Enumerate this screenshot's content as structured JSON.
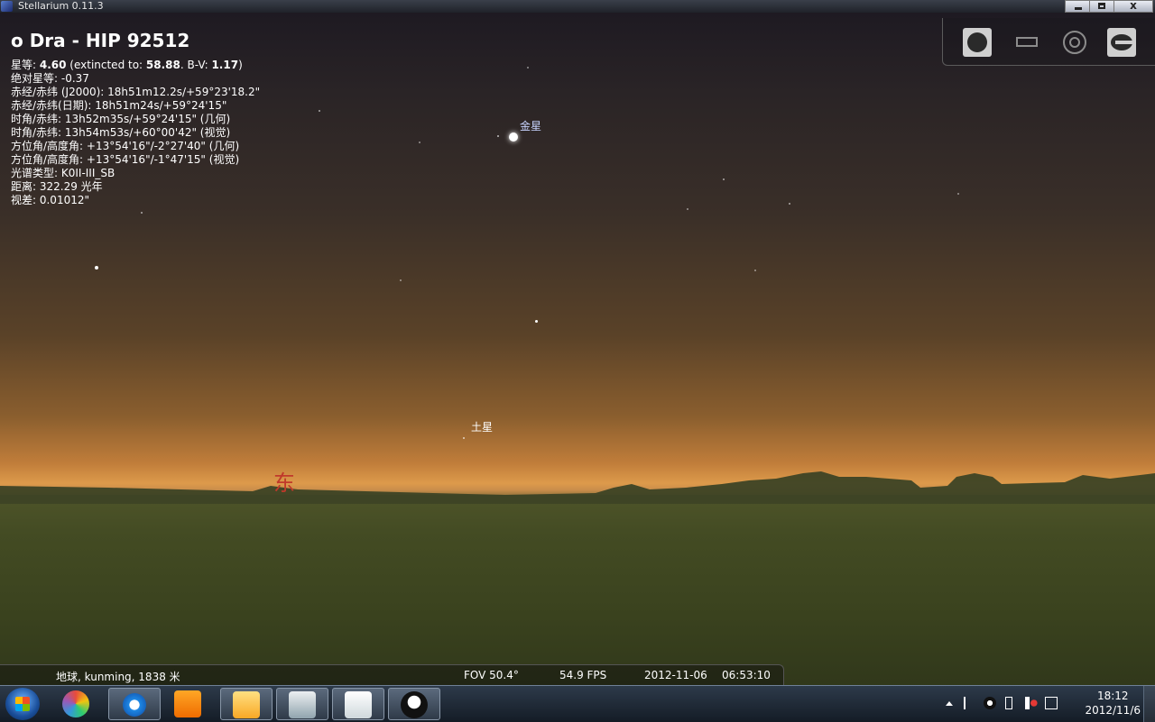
{
  "window": {
    "title": "Stellarium 0.11.3"
  },
  "info_panel": {
    "object_name": "o Dra - HIP 92512",
    "magnitude_label": "星等: ",
    "magnitude": "4.60",
    "extincted_label": " (extincted to: ",
    "extincted": "58.88",
    "bv_label": ". B-V: ",
    "bv": "1.17",
    "bv_close": ")",
    "lines": [
      "绝对星等: -0.37",
      "赤经/赤纬 (J2000): 18h51m12.2s/+59°23'18.2\"",
      "赤经/赤纬(日期): 18h51m24s/+59°24'15\"",
      "时角/赤纬: 13h52m35s/+59°24'15\" (几何)",
      "时角/赤纬: 13h54m53s/+60°00'42\" (视觉)",
      "方位角/高度角: +13°54'16\"/-2°27'40\" (几何)",
      "方位角/高度角: +13°54'16\"/-1°47'15\" (视觉)",
      "光谱类型: K0II-III_SB",
      "距离: 322.29 光年",
      "视差: 0.01012\""
    ]
  },
  "sky_labels": {
    "venus": "金星",
    "saturn": "土星",
    "east": "东"
  },
  "toolbar": {
    "icons": [
      "atmosphere-icon",
      "landscape-icon",
      "ground-icon",
      "config-icon"
    ]
  },
  "status": {
    "location": "地球, kunming, 1838 米",
    "fov": "FOV 50.4°",
    "fps": "54.9 FPS",
    "date": "2012-11-06",
    "time": "06:53:10"
  },
  "taskbar": {
    "clock_time": "18:12",
    "clock_date": "2012/11/6"
  },
  "colors": {
    "compass_red": "#c0392b",
    "planet_label": "#c8d4ff"
  }
}
